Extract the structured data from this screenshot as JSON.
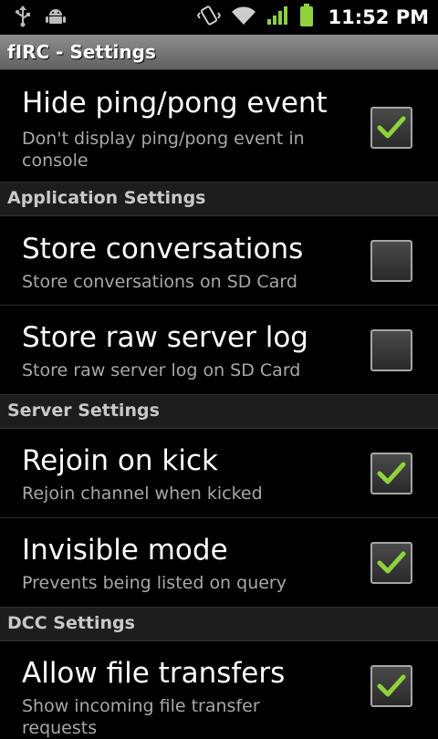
{
  "status_bar": {
    "time": "11:52 PM",
    "icons": [
      "usb-icon",
      "android-debug-icon",
      "vibrate-icon",
      "wifi-icon",
      "signal-icon",
      "battery-icon"
    ]
  },
  "app": {
    "title": "fIRC - Settings"
  },
  "colors": {
    "check": "#8ed23c",
    "category_bg": "#1d1d1d",
    "summary": "#a8a8a8"
  },
  "preferences": [
    {
      "title": "Hide ping/pong event",
      "summary": "Don't display ping/pong event in console",
      "checked": true
    },
    {
      "category": "Application Settings"
    },
    {
      "title": "Store conversations",
      "summary": "Store conversations on SD Card",
      "checked": false
    },
    {
      "title": "Store raw server log",
      "summary": "Store raw server log on SD Card",
      "checked": false
    },
    {
      "category": "Server Settings"
    },
    {
      "title": "Rejoin on kick",
      "summary": "Rejoin channel when kicked",
      "checked": true
    },
    {
      "title": "Invisible mode",
      "summary": "Prevents being listed on query",
      "checked": true
    },
    {
      "category": "DCC Settings"
    },
    {
      "title": "Allow file transfers",
      "summary": "Show incoming file transfer requests",
      "checked": true
    }
  ]
}
